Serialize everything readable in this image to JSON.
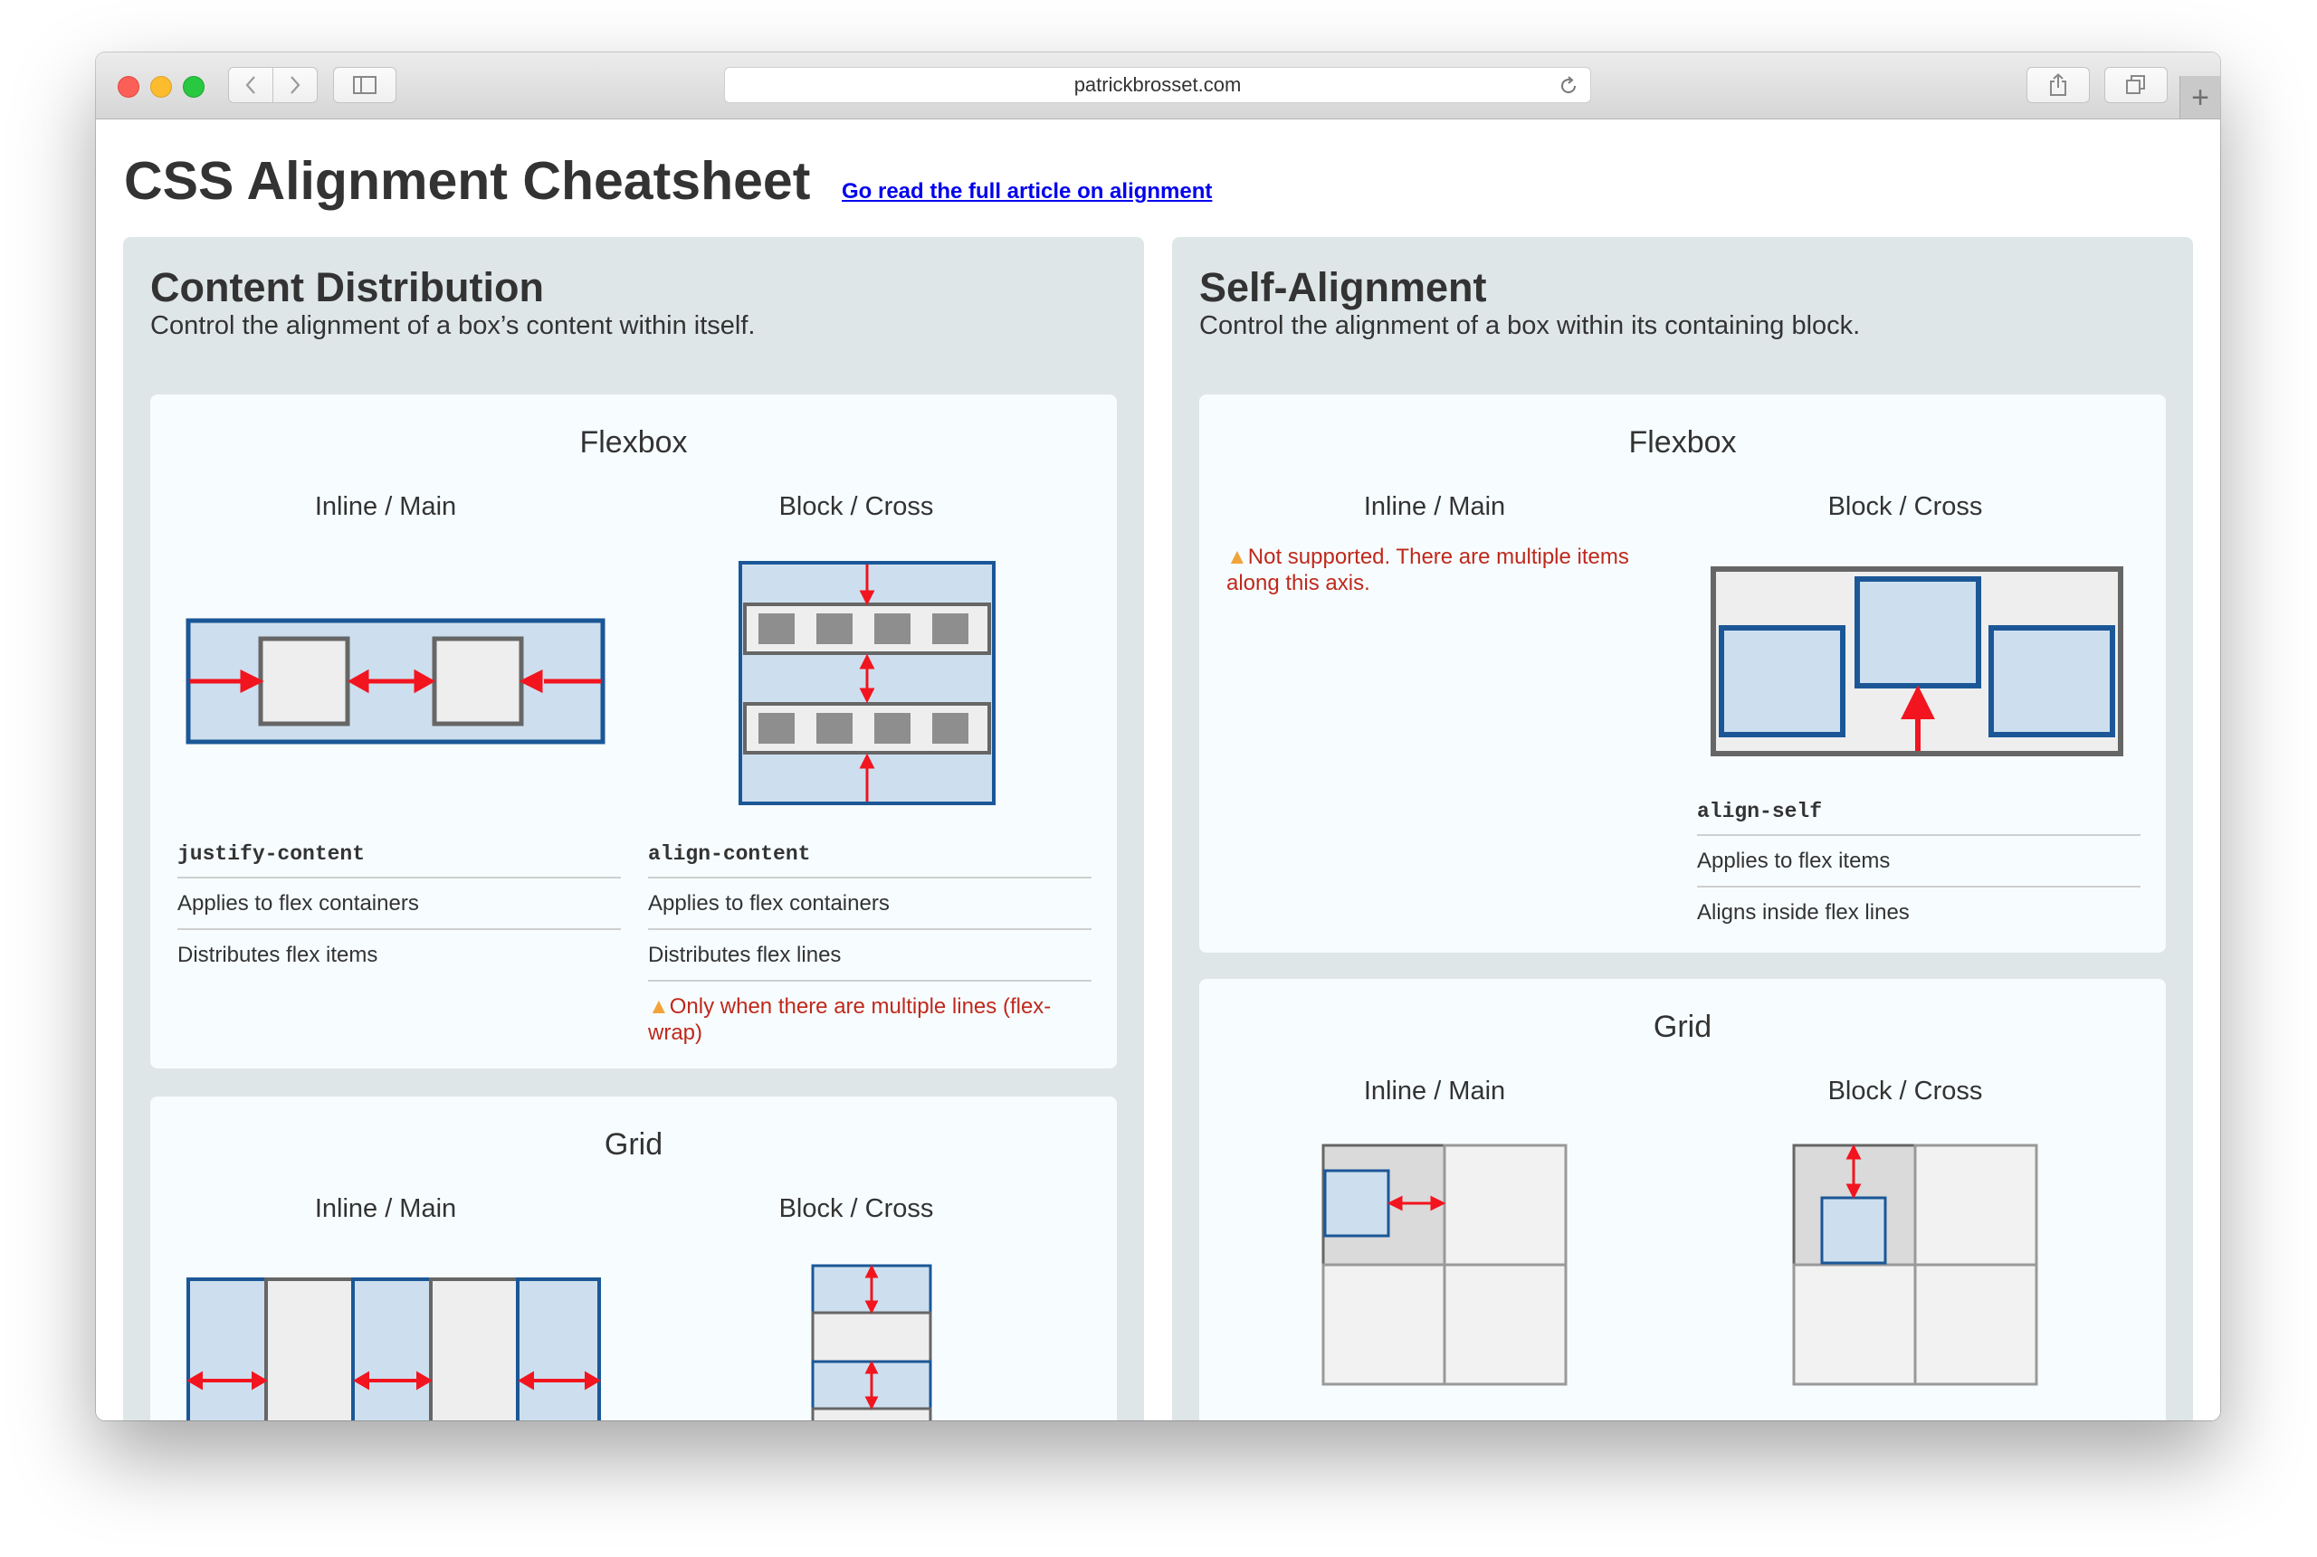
{
  "browser": {
    "url": "patrickbrosset.com",
    "plus_label": "+"
  },
  "page": {
    "title": "CSS Alignment Cheatsheet",
    "link": "Go read the full article on alignment"
  },
  "content_distribution": {
    "title": "Content Distribution",
    "subtitle": "Control the alignment of a box’s content within itself.",
    "flexbox": {
      "title": "Flexbox",
      "inline_head": "Inline / Main",
      "block_head": "Block / Cross",
      "inline_prop": "justify-content",
      "inline_rows": [
        "Applies to flex containers",
        "Distributes flex items"
      ],
      "block_prop": "align-content",
      "block_rows": [
        "Applies to flex containers",
        "Distributes flex lines"
      ],
      "block_warning": "Only when there are multiple lines (flex-wrap)"
    },
    "grid": {
      "title": "Grid",
      "inline_head": "Inline / Main",
      "block_head": "Block / Cross"
    }
  },
  "self_alignment": {
    "title": "Self-Alignment",
    "subtitle": "Control the alignment of a box within its containing block.",
    "flexbox": {
      "title": "Flexbox",
      "inline_head": "Inline / Main",
      "block_head": "Block / Cross",
      "inline_warning": "Not supported. There are multiple items along this axis.",
      "block_prop": "align-self",
      "block_rows": [
        "Applies to flex items",
        "Aligns inside flex lines"
      ]
    },
    "grid": {
      "title": "Grid",
      "inline_head": "Inline / Main",
      "block_head": "Block / Cross"
    }
  },
  "colors": {
    "diagram_blue": "#1b5797",
    "diagram_fill": "#cddfee",
    "arrow_red": "#f2141e",
    "item_gray": "#666666",
    "warning_red": "#c0281c",
    "warning_icon": "#f2a33a",
    "section_bg": "#dfe6e8",
    "card_bg": "#f7fdff"
  }
}
